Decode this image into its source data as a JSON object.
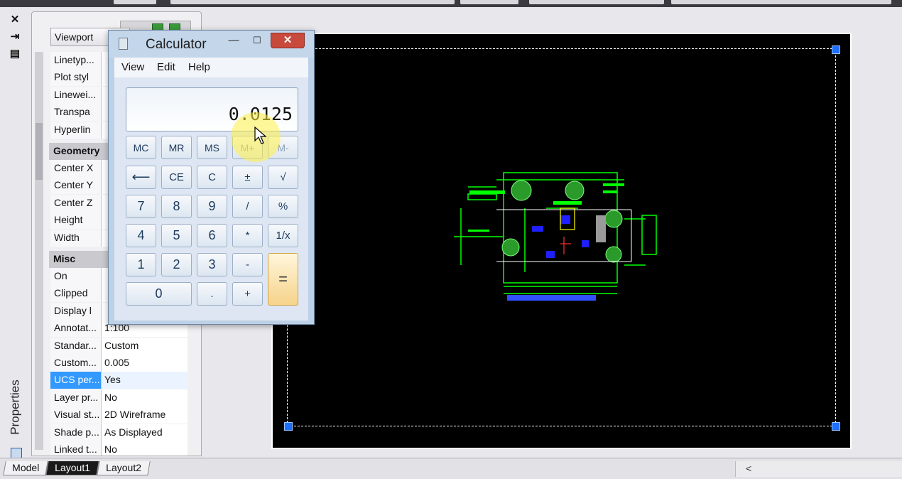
{
  "palette": {
    "title_vertical": "Properties",
    "close_icon_glyph": "✕",
    "autohide_icon_glyph": "⇥",
    "props_icon_glyph": "▤"
  },
  "properties": {
    "object_type": "Viewport",
    "categories": {
      "geometry": "Geometry",
      "misc": "Misc"
    },
    "rows_top": [
      {
        "k": "Linetyp...",
        "v": ""
      },
      {
        "k": "Plot styl",
        "v": ""
      },
      {
        "k": "Linewei...",
        "v": ""
      },
      {
        "k": "Transpa",
        "v": ""
      },
      {
        "k": "Hyperlin",
        "v": ""
      }
    ],
    "rows_geometry": [
      {
        "k": "Center X",
        "v": ""
      },
      {
        "k": "Center Y",
        "v": ""
      },
      {
        "k": "Center Z",
        "v": ""
      },
      {
        "k": "Height",
        "v": ""
      },
      {
        "k": "Width",
        "v": ""
      }
    ],
    "rows_misc": [
      {
        "k": "On",
        "v": ""
      },
      {
        "k": "Clipped",
        "v": ""
      },
      {
        "k": "Display l",
        "v": ""
      },
      {
        "k": "Annotat...",
        "v": "1:100"
      },
      {
        "k": "Standar...",
        "v": "Custom"
      },
      {
        "k": "Custom...",
        "v": "0.005"
      },
      {
        "k": "UCS per...",
        "v": "Yes"
      },
      {
        "k": "Layer pr...",
        "v": "No"
      },
      {
        "k": "Visual st...",
        "v": "2D Wireframe"
      },
      {
        "k": "Shade p...",
        "v": "As Displayed"
      },
      {
        "k": "Linked t...",
        "v": "No"
      }
    ],
    "selected_row": "UCS per..."
  },
  "calculator": {
    "title": "Calculator",
    "min_glyph": "—",
    "max_glyph": "☐",
    "close_glyph": "✕",
    "menu": [
      "View",
      "Edit",
      "Help"
    ],
    "display_value": "0.0125",
    "memory_buttons": [
      "MC",
      "MR",
      "MS",
      "M+",
      "M-"
    ],
    "row2": [
      "⟵",
      "CE",
      "C",
      "±",
      "√"
    ],
    "row3": [
      "7",
      "8",
      "9",
      "/",
      "%"
    ],
    "row4": [
      "4",
      "5",
      "6",
      "*",
      "1/x"
    ],
    "row5": [
      "1",
      "2",
      "3",
      "-"
    ],
    "row6": [
      "0",
      ".",
      "+"
    ],
    "equals": "="
  },
  "tabs": [
    "Model",
    "Layout1",
    "Layout2"
  ],
  "active_tab": "Layout1",
  "hscroll_arrow": "<",
  "colors": {
    "paper": "#000000",
    "grip": "#1e6fff",
    "plan_green": "#00ff00",
    "plan_blue": "#2020ff",
    "selection": "#3399ff",
    "calc_close": "#c84a3c",
    "equals_button": "#f6d38a"
  }
}
